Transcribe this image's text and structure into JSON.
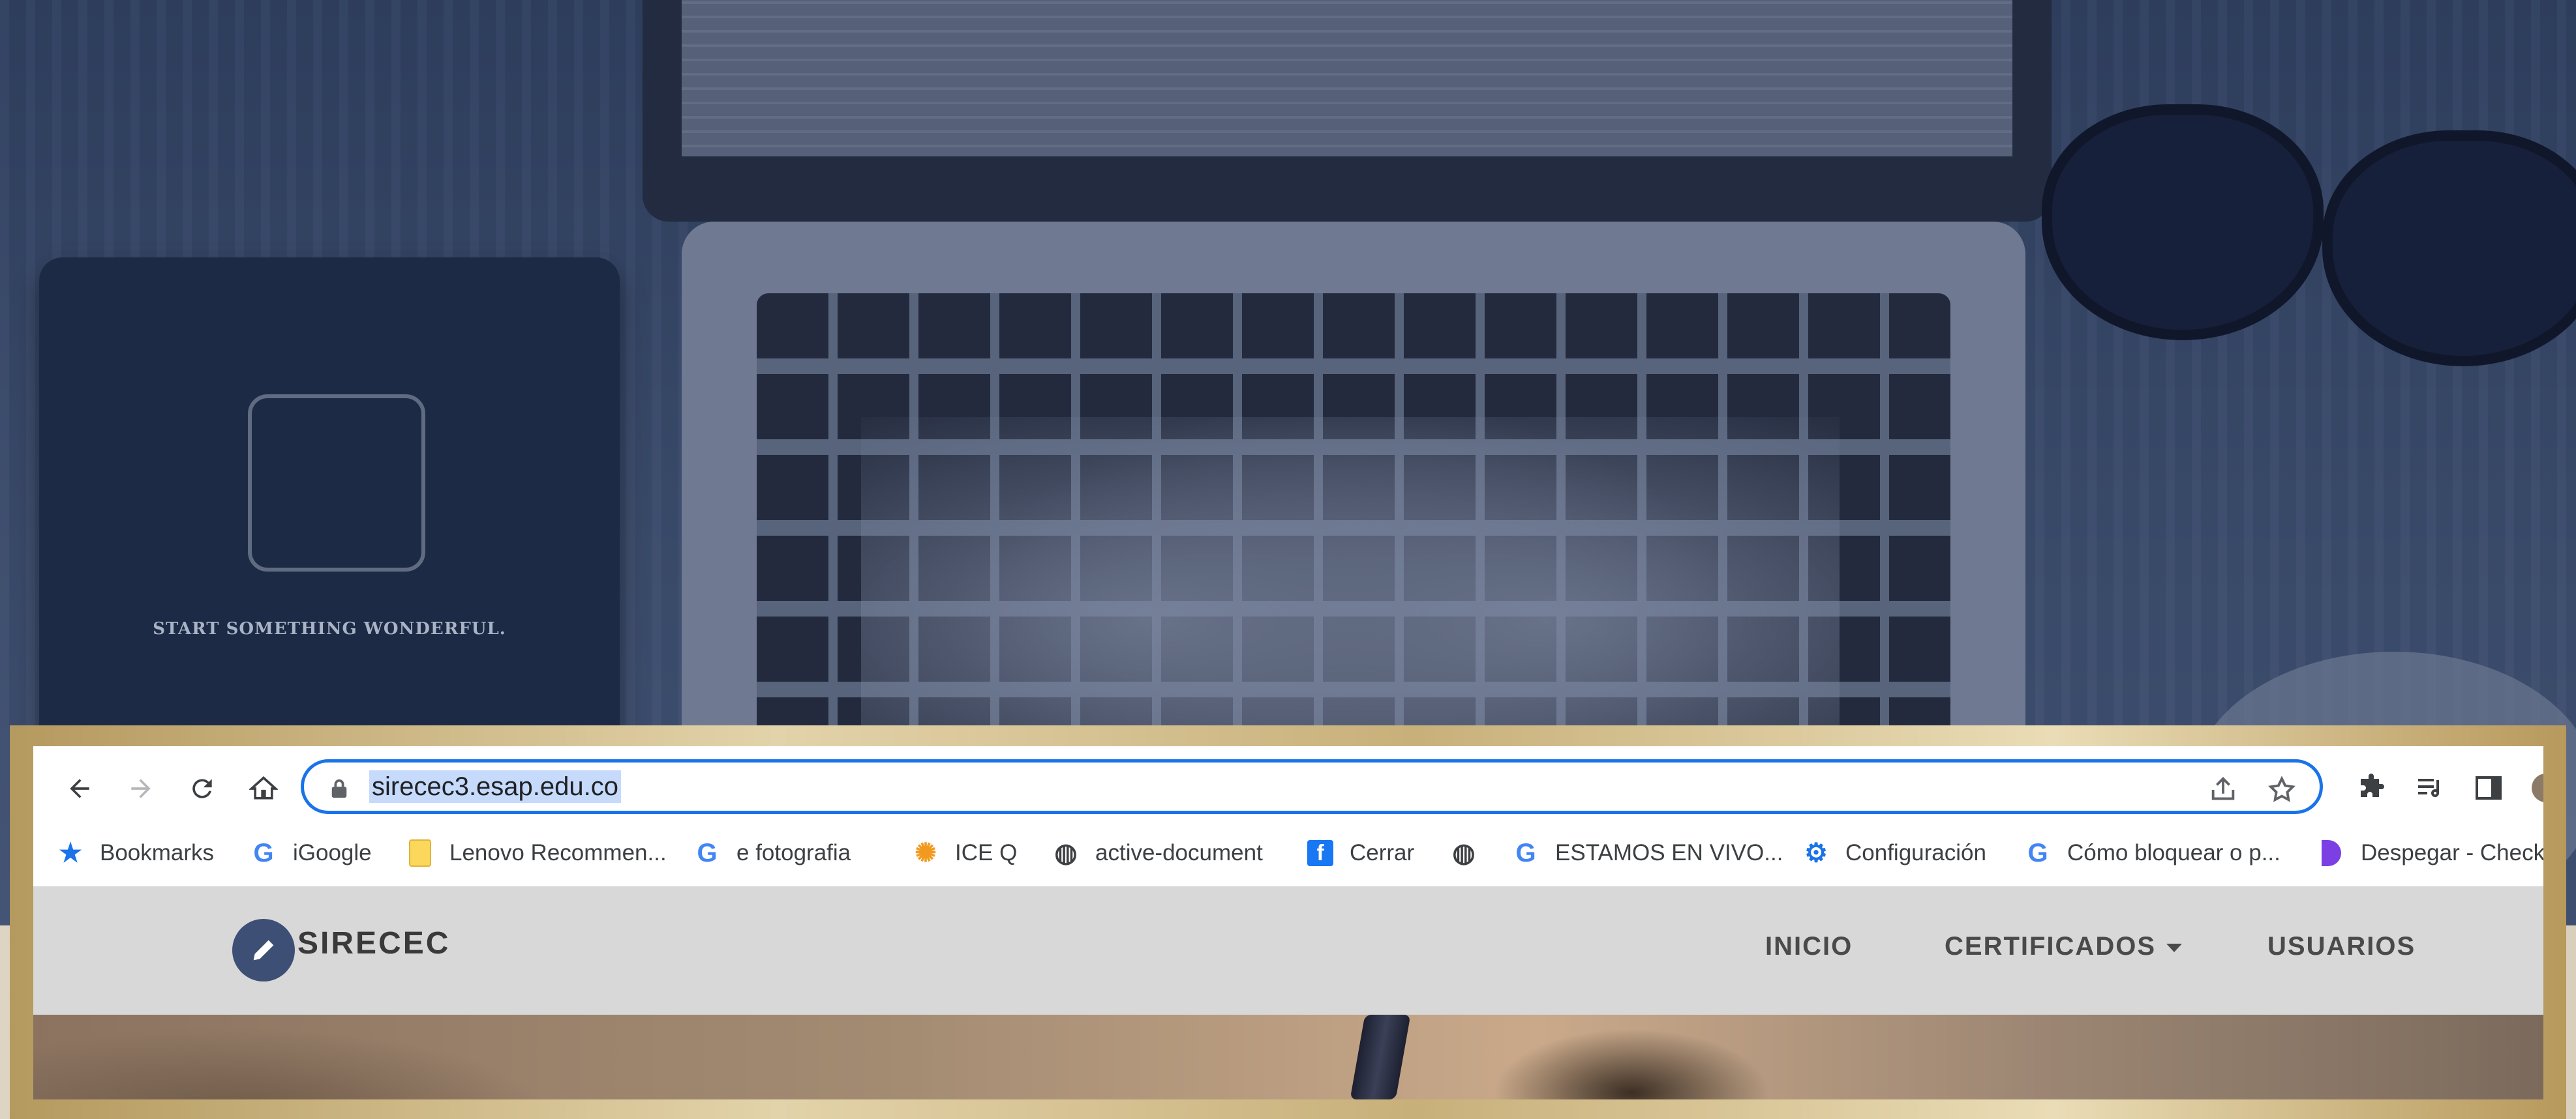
{
  "background": {
    "notebook_text": "START SOMETHING WONDERFUL."
  },
  "browser": {
    "nav": {
      "back_icon": "arrow-left-icon",
      "forward_icon": "arrow-right-icon",
      "reload_icon": "reload-icon",
      "home_icon": "home-icon"
    },
    "omnibox": {
      "url": "sirecec3.esap.edu.co",
      "selected": true
    },
    "bookmarks": [
      {
        "label": "Bookmarks",
        "icon": "star-icon"
      },
      {
        "label": "iGoogle",
        "icon": "google-icon"
      },
      {
        "label": "Lenovo Recommen...",
        "icon": "folder-icon"
      },
      {
        "label": "e fotografia",
        "icon": "google-icon"
      },
      {
        "label": "ICE Q",
        "icon": "flower-icon"
      },
      {
        "label": "active-document",
        "icon": "globe-icon"
      },
      {
        "label": "Cerrar",
        "icon": "facebook-icon"
      },
      {
        "label": "",
        "icon": "globe-icon"
      },
      {
        "label": "ESTAMOS EN VIVO...",
        "icon": "google-icon"
      },
      {
        "label": "Configuración",
        "icon": "gear-icon"
      },
      {
        "label": "Cómo bloquear o p...",
        "icon": "google-icon"
      },
      {
        "label": "Despegar - Checkout",
        "icon": "despegar-icon"
      }
    ]
  },
  "site": {
    "brand": "SIRECEC",
    "menu": {
      "inicio": "INICIO",
      "certificados": "CERTIFICADOS",
      "usuarios": "USUARIOS"
    }
  },
  "colors": {
    "accent": "#1a73e8",
    "brand_logo": "#3d4f74",
    "navbar": "#d8d8d8",
    "frame_gold": "#c8b07a"
  }
}
